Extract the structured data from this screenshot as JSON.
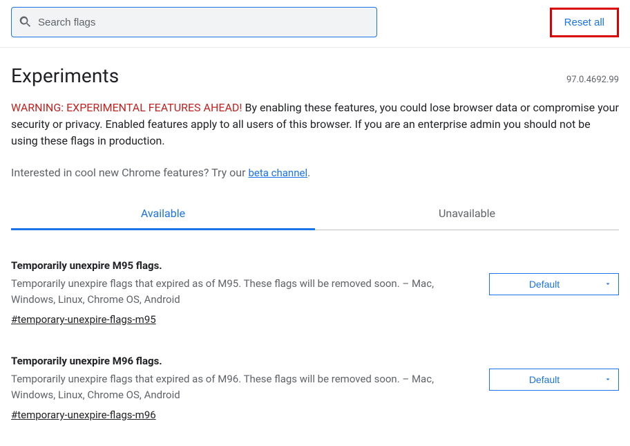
{
  "search": {
    "placeholder": "Search flags"
  },
  "reset_label": "Reset all",
  "title": "Experiments",
  "version": "97.0.4692.99",
  "warning_prefix": "WARNING: EXPERIMENTAL FEATURES AHEAD!",
  "warning_body": " By enabling these features, you could lose browser data or compromise your security or privacy. Enabled features apply to all users of this browser. If you are an enterprise admin you should not be using these flags in production.",
  "interest_prefix": "Interested in cool new Chrome features? Try our ",
  "interest_link_text": "beta channel",
  "interest_suffix": ".",
  "tabs": {
    "available": "Available",
    "unavailable": "Unavailable"
  },
  "flags": [
    {
      "title": "Temporarily unexpire M95 flags.",
      "desc": "Temporarily unexpire flags that expired as of M95. These flags will be removed soon. – Mac, Windows, Linux, Chrome OS, Android",
      "anchor": "#temporary-unexpire-flags-m95",
      "select_value": "Default"
    },
    {
      "title": "Temporarily unexpire M96 flags.",
      "desc": "Temporarily unexpire flags that expired as of M96. These flags will be removed soon. – Mac, Windows, Linux, Chrome OS, Android",
      "anchor": "#temporary-unexpire-flags-m96",
      "select_value": "Default"
    }
  ]
}
